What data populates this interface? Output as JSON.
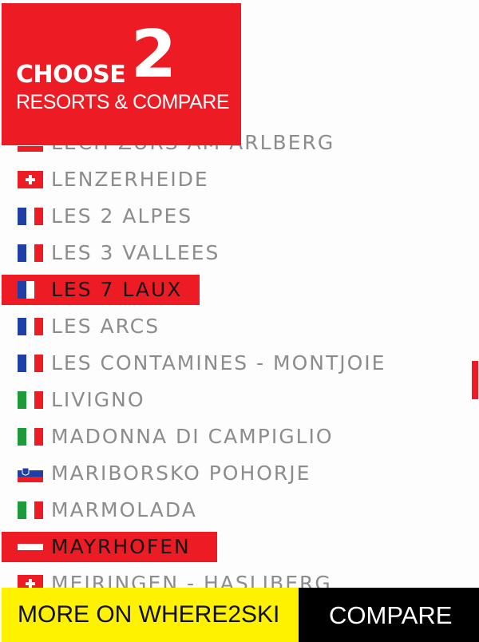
{
  "header": {
    "choose": "CHOOSE",
    "number": "2",
    "subtitle": "RESORTS & COMPARE"
  },
  "resorts": [
    {
      "name": "LECH ZURS AM ARLBERG",
      "flag": "flag-austria-icon",
      "selected": false
    },
    {
      "name": "LENZERHEIDE",
      "flag": "flag-switzerland-icon",
      "selected": false
    },
    {
      "name": "LES 2 ALPES",
      "flag": "flag-france-icon",
      "selected": false
    },
    {
      "name": "LES 3 VALLEES",
      "flag": "flag-france-icon",
      "selected": false
    },
    {
      "name": "LES 7 LAUX",
      "flag": "flag-france-icon",
      "selected": true
    },
    {
      "name": "LES ARCS",
      "flag": "flag-france-icon",
      "selected": false
    },
    {
      "name": "LES CONTAMINES - MONTJOIE",
      "flag": "flag-france-icon",
      "selected": false
    },
    {
      "name": "LIVIGNO",
      "flag": "flag-italy-icon",
      "selected": false
    },
    {
      "name": "MADONNA DI CAMPIGLIO",
      "flag": "flag-italy-icon",
      "selected": false
    },
    {
      "name": "MARIBORSKO POHORJE",
      "flag": "flag-slovenia-icon",
      "selected": false
    },
    {
      "name": "MARMOLADA",
      "flag": "flag-italy-icon",
      "selected": false
    },
    {
      "name": "MAYRHOFEN",
      "flag": "flag-austria-icon",
      "selected": true
    },
    {
      "name": "MEIRINGEN - HASLIBERG",
      "flag": "flag-switzerland-icon",
      "selected": false
    }
  ],
  "footer": {
    "more_label": "MORE ON WHERE2SKI",
    "compare_label": "COMPARE"
  },
  "colors": {
    "accent": "#ed1c24",
    "footer_more_bg": "#fff200",
    "footer_compare_bg": "#000000",
    "list_text": "#8c8c8c"
  }
}
